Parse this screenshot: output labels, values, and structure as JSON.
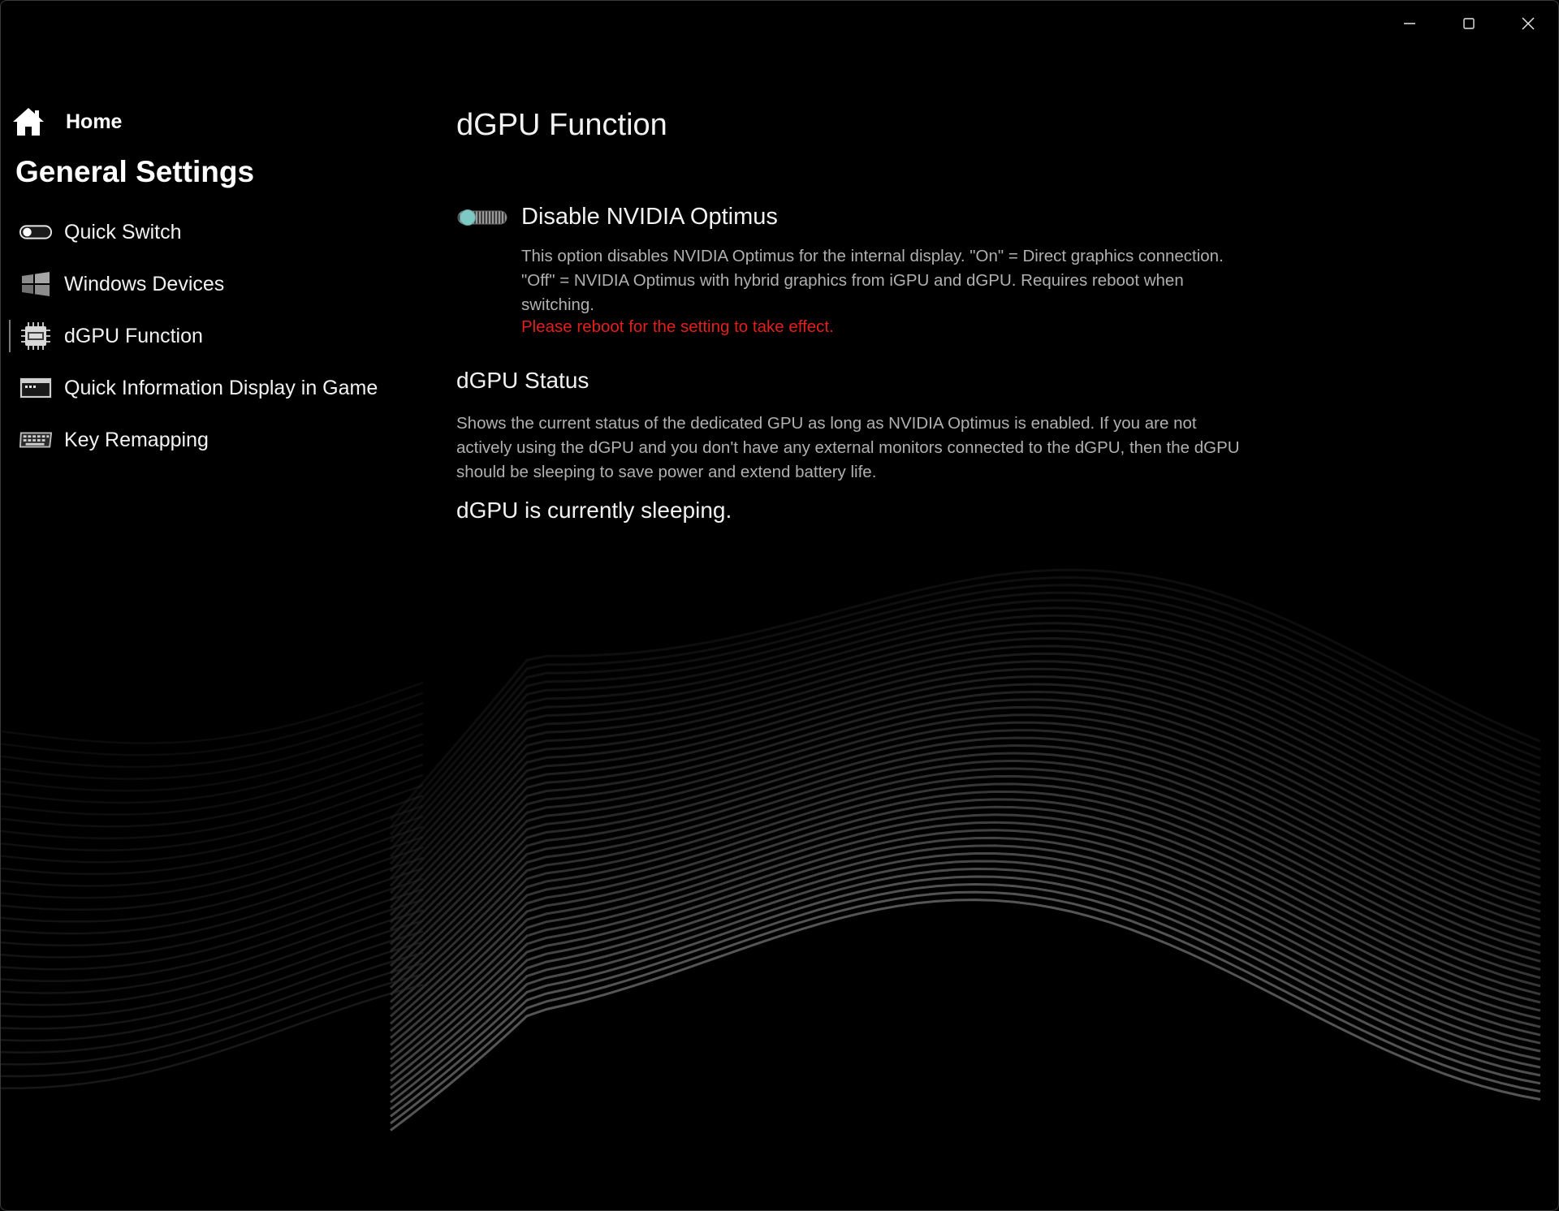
{
  "window": {
    "controls": {
      "minimize_icon": "minimize-icon",
      "maximize_icon": "maximize-icon",
      "close_icon": "close-icon"
    }
  },
  "sidebar": {
    "home": {
      "label": "Home",
      "icon": "home-icon"
    },
    "section_title": "General Settings",
    "items": [
      {
        "label": "Quick Switch",
        "icon": "toggle-switch-icon",
        "selected": false
      },
      {
        "label": "Windows Devices",
        "icon": "windows-logo-icon",
        "selected": false
      },
      {
        "label": "dGPU Function",
        "icon": "gpu-chip-icon",
        "selected": true
      },
      {
        "label": "Quick Information Display in Game",
        "icon": "display-window-icon",
        "selected": false
      },
      {
        "label": "Key Remapping",
        "icon": "keyboard-icon",
        "selected": false
      }
    ]
  },
  "main": {
    "title": "dGPU Function",
    "optimus": {
      "label": "Disable NVIDIA Optimus",
      "toggle_state": "off",
      "description": "This option disables NVIDIA Optimus for the internal display. \"On\" = Direct graphics connection. \"Off\" = NVIDIA Optimus with hybrid graphics from iGPU and dGPU. Requires reboot when switching.",
      "reboot_note": "Please reboot for the setting to take effect."
    },
    "status": {
      "heading": "dGPU Status",
      "description": "Shows the current status of the dedicated GPU as long as NVIDIA Optimus is enabled. If you are not actively using the dGPU and you don't have any external monitors connected to the dGPU, then the dGPU should be sleeping to save power and extend battery life.",
      "value": "dGPU is currently sleeping."
    }
  },
  "colors": {
    "background": "#000000",
    "text": "#f2f2f2",
    "secondary_text": "#b0b0b0",
    "warning": "#e0201e",
    "toggle_accent": "#7fc9c4"
  }
}
